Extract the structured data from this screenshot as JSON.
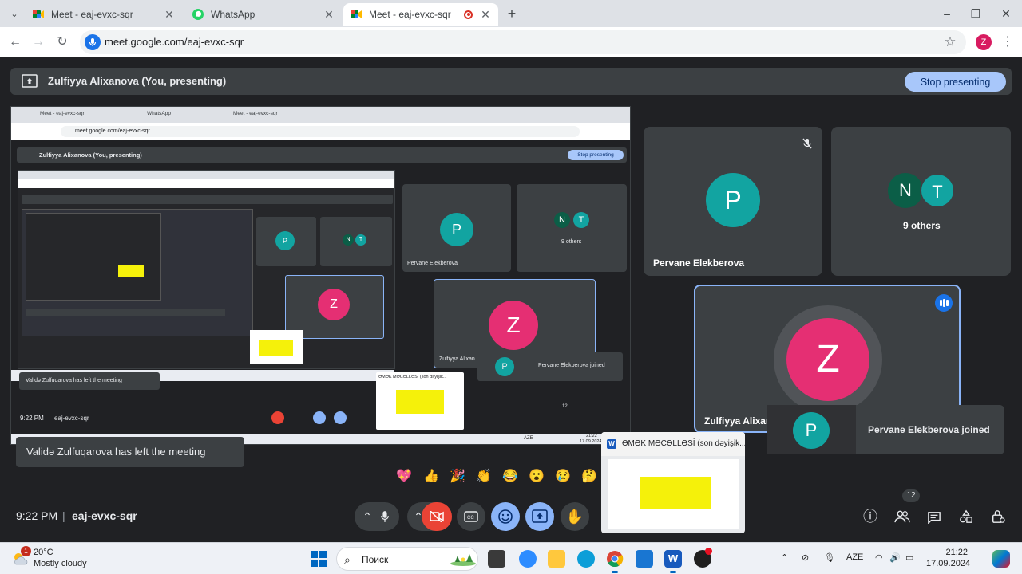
{
  "browser": {
    "tabs": [
      {
        "title": "Meet - eaj-evxc-sqr",
        "icon": "meet-icon",
        "active": false
      },
      {
        "title": "WhatsApp",
        "icon": "whatsapp-icon",
        "active": false
      },
      {
        "title": "Meet - eaj-evxc-sqr",
        "icon": "meet-icon",
        "active": true,
        "recording": true
      }
    ],
    "url": "meet.google.com/eaj-evxc-sqr",
    "profile_initial": "Z"
  },
  "meet": {
    "presenting_text": "Zulfiyya Alixanova (You, presenting)",
    "stop_presenting_label": "Stop presenting",
    "shared_screen": {
      "tabs": [
        "Meet - eaj-evxc-sqr",
        "WhatsApp",
        "Meet - eaj-evxc-sqr"
      ],
      "url": "meet.google.com/eaj-evxc-sqr",
      "presenting_text": "Zulfiyya Alixanova (You, presenting)",
      "stop_label": "Stop presenting",
      "tile1_name": "Pervane Elekberova",
      "tile2_others": "9 others",
      "self_name": "Zulfiyya Alixan",
      "joined_text": "Pervane Elekberova joined",
      "toast_text": "Validə Zulfuqarova has left the meeting",
      "clock": "9:22 PM",
      "code": "eaj-evxc-sqr",
      "doc_title": "ƏMƏK MƏCƏLLƏSİ (son dəyişik...",
      "people_count": "12",
      "taskbar_time": "21:22",
      "taskbar_date": "17.09.2024",
      "taskbar_lang": "AZE"
    },
    "tiles": [
      {
        "initial": "P",
        "name": "Pervane Elekberova",
        "color": "#12a4a1",
        "muted": true
      },
      {
        "initials": [
          "N",
          "T"
        ],
        "colors": [
          "#0b5e47",
          "#12a4a1"
        ],
        "label": "9 others"
      },
      {
        "initial": "Z",
        "name": "Zulfiyya Alixan",
        "color": "#e52f73",
        "speaking": true
      }
    ],
    "joined_notification": {
      "initial": "P",
      "text": "Pervane Elekberova joined",
      "color": "#12a4a1"
    },
    "toast": "Validə Zulfuqarova has left the meeting",
    "reactions": [
      "💖",
      "👍",
      "🎉",
      "👏",
      "😂",
      "😮",
      "😢",
      "🤔"
    ],
    "window_preview": {
      "title": "ƏMƏK MƏCƏLLƏSİ (son dəyişik...",
      "app_icon": "word-icon"
    },
    "clock": "9:22 PM",
    "separator": "|",
    "meeting_code": "eaj-evxc-sqr",
    "controls": [
      "more-options-icon",
      "mic-icon",
      "camera-off-icon",
      "captions-icon",
      "emoji-icon",
      "present-icon",
      "raise-hand-icon"
    ],
    "right_controls": [
      "info-icon",
      "people-icon",
      "chat-icon",
      "activities-icon",
      "host-controls-icon"
    ],
    "people_count": "12"
  },
  "taskbar": {
    "weather_badge": "1",
    "temperature": "20°C",
    "condition": "Mostly cloudy",
    "search_placeholder": "Поиск",
    "language": "AZE",
    "time": "21:22",
    "date": "17.09.2024"
  },
  "colors": {
    "meet_bg": "#202124",
    "tile_bg": "#3c4043",
    "accent_blue": "#a8c7fa",
    "end_call_red": "#ea4335",
    "p_avatar": "#12a4a1",
    "z_avatar": "#e52f73"
  }
}
